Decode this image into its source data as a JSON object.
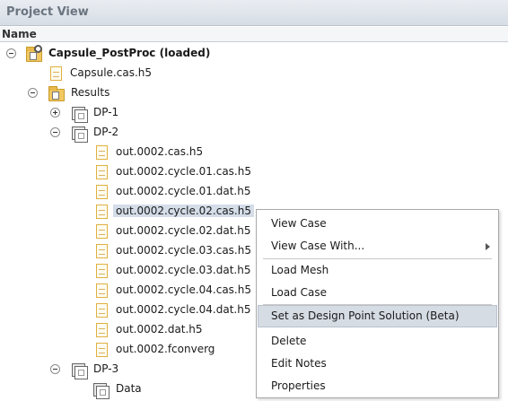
{
  "panel": {
    "title": "Project View"
  },
  "columns": {
    "name": "Name"
  },
  "tree": {
    "root": "Capsule_PostProc (loaded)",
    "case_file": "Capsule.cas.h5",
    "results": "Results",
    "dp1": "DP-1",
    "dp2": "DP-2",
    "dp2_files": [
      "out.0002.cas.h5",
      "out.0002.cycle.01.cas.h5",
      "out.0002.cycle.01.dat.h5",
      "out.0002.cycle.02.cas.h5",
      "out.0002.cycle.02.dat.h5",
      "out.0002.cycle.03.cas.h5",
      "out.0002.cycle.03.dat.h5",
      "out.0002.cycle.04.cas.h5",
      "out.0002.cycle.04.dat.h5",
      "out.0002.dat.h5",
      "out.0002.fconverg"
    ],
    "dp3": "DP-3",
    "dp3_data": "Data",
    "selected_file": "out.0002.cycle.02.cas.h5"
  },
  "context_menu": {
    "items": [
      "View Case",
      "View Case With...",
      "Load Mesh",
      "Load Case",
      "Set as Design Point Solution (Beta)",
      "Delete",
      "Edit Notes",
      "Properties"
    ],
    "highlighted": "Set as Design Point Solution (Beta)"
  },
  "icons": {
    "expander_open": "collapse-icon",
    "expander_closed": "expand-icon",
    "project": "project-folder-icon",
    "file": "file-icon",
    "folder": "folder-icon",
    "design_point": "design-point-icon",
    "submenu": "chevron-right-icon"
  },
  "colors": {
    "header_bg": "#dce2e9",
    "selection": "#d4dde8",
    "menu_highlight": "#d6dce4",
    "file_border": "#e0b040",
    "folder": "#f2c960"
  }
}
